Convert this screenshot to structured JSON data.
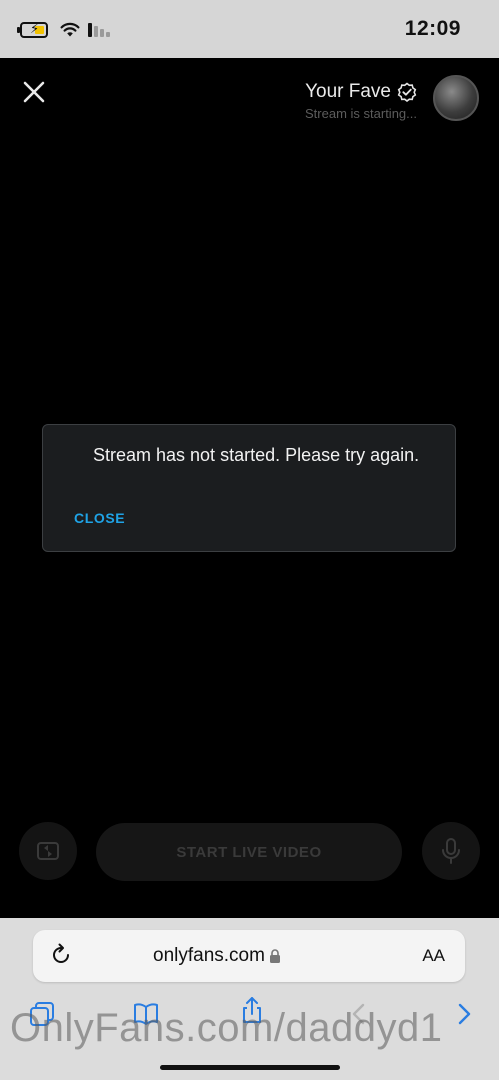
{
  "status_bar": {
    "time": "12:09"
  },
  "stream_header": {
    "creator_name": "Your Fave",
    "status_text": "Stream is starting..."
  },
  "dialog": {
    "message": "Stream has not started. Please try again.",
    "close_label": "CLOSE"
  },
  "controls": {
    "start_live_label": "START LIVE VIDEO"
  },
  "browser": {
    "url": "onlyfans.com",
    "text_size_label": "AA"
  },
  "watermark": {
    "text": "OnlyFans.com/daddyd1"
  },
  "colors": {
    "accent": "#1fa3e6",
    "background": "#000000",
    "dialog_bg": "#1b1d1f",
    "browser_bar": "#dcdcdc"
  }
}
